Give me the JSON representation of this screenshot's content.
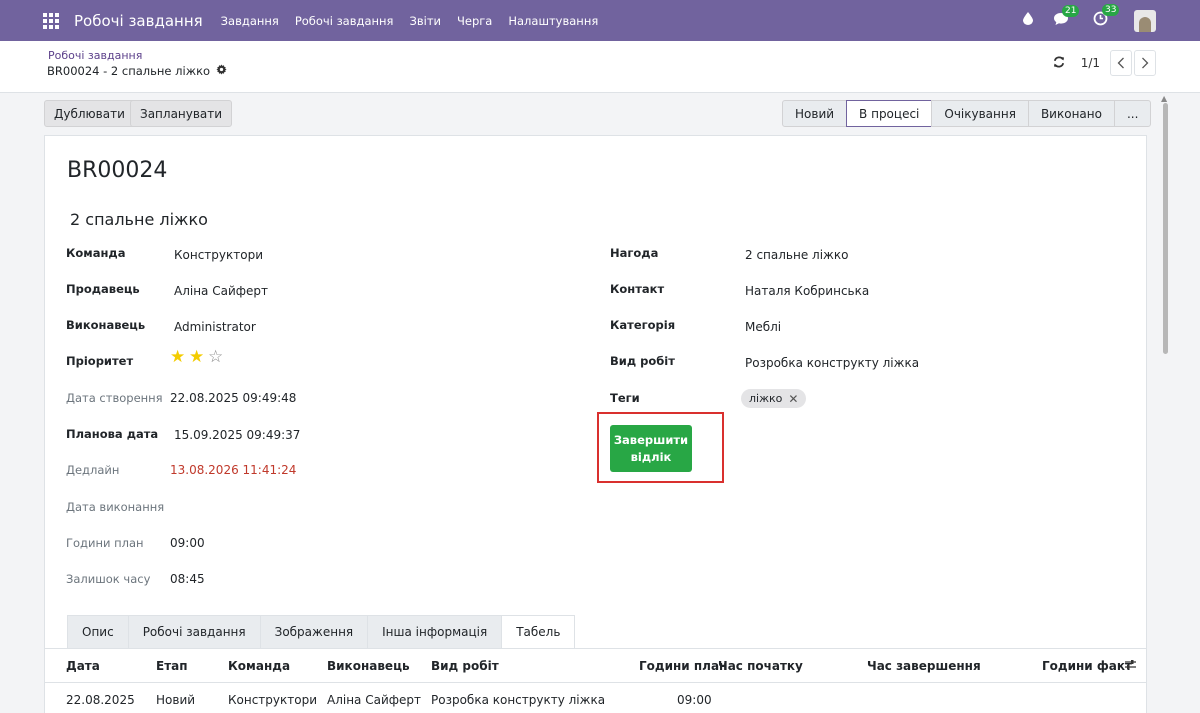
{
  "navbar": {
    "app_name": "Робочі завдання",
    "menu": [
      "Завдання",
      "Робочі завдання",
      "Звіти",
      "Черга",
      "Налаштування"
    ],
    "chat_badge": "21",
    "activity_badge": "33"
  },
  "breadcrumb": {
    "parent": "Робочі завдання",
    "current": "BR00024 - 2 спальне ліжко"
  },
  "pager": {
    "value": "1/1"
  },
  "actions": {
    "duplicate": "Дублювати",
    "schedule": "Запланувати"
  },
  "stages": [
    "Новий",
    "В процесі",
    "Очікування",
    "Виконано",
    "..."
  ],
  "active_stage": "В процесі",
  "record": {
    "code": "BR00024",
    "title": "2 спальне ліжко",
    "left_fields": [
      {
        "label": "Команда",
        "value": "Конструктори"
      },
      {
        "label": "Продавець",
        "value": "Аліна Сайферт"
      },
      {
        "label": "Виконавець",
        "value": "Administrator"
      },
      {
        "label": "Пріоритет",
        "value": ""
      },
      {
        "label": "Дата створення",
        "value": "22.08.2025 09:49:48"
      },
      {
        "label": "Планова дата",
        "value": "15.09.2025 09:49:37"
      },
      {
        "label": "Дедлайн",
        "value": "13.08.2026 11:41:24"
      },
      {
        "label": "Дата виконання",
        "value": ""
      },
      {
        "label": "Години план",
        "value": "09:00"
      },
      {
        "label": "Залишок часу",
        "value": "08:45"
      }
    ],
    "priority_stars": 2,
    "priority_max": 3,
    "right_fields": [
      {
        "label": "Нагода",
        "value": "2 спальне ліжко"
      },
      {
        "label": "Контакт",
        "value": "Наталя Кобринська"
      },
      {
        "label": "Категорія",
        "value": "Меблі"
      },
      {
        "label": "Вид робіт",
        "value": "Розробка конструкту ліжка"
      },
      {
        "label": "Теги",
        "value": ""
      }
    ],
    "tags": [
      "ліжко"
    ],
    "finish_button": "Завершити відлік"
  },
  "tabs": [
    "Опис",
    "Робочі завдання",
    "Зображення",
    "Інша інформація",
    "Табель"
  ],
  "active_tab": "Табель",
  "timesheet": {
    "columns": [
      "Дата",
      "Етап",
      "Команда",
      "Виконавець",
      "Вид робіт",
      "Години план",
      "Час початку",
      "Час завершення",
      "Години факт"
    ],
    "rows": [
      [
        "22.08.2025",
        "Новий",
        "Конструктори",
        "Аліна Сайферт",
        "Розробка конструкту ліжка",
        "09:00",
        "",
        "",
        ""
      ]
    ]
  },
  "colors": {
    "navbar": "#71639e",
    "primary_button": "#28a745",
    "deadline": "#c0392b",
    "star": "#f3cc00",
    "highlight": "#d9302e"
  }
}
